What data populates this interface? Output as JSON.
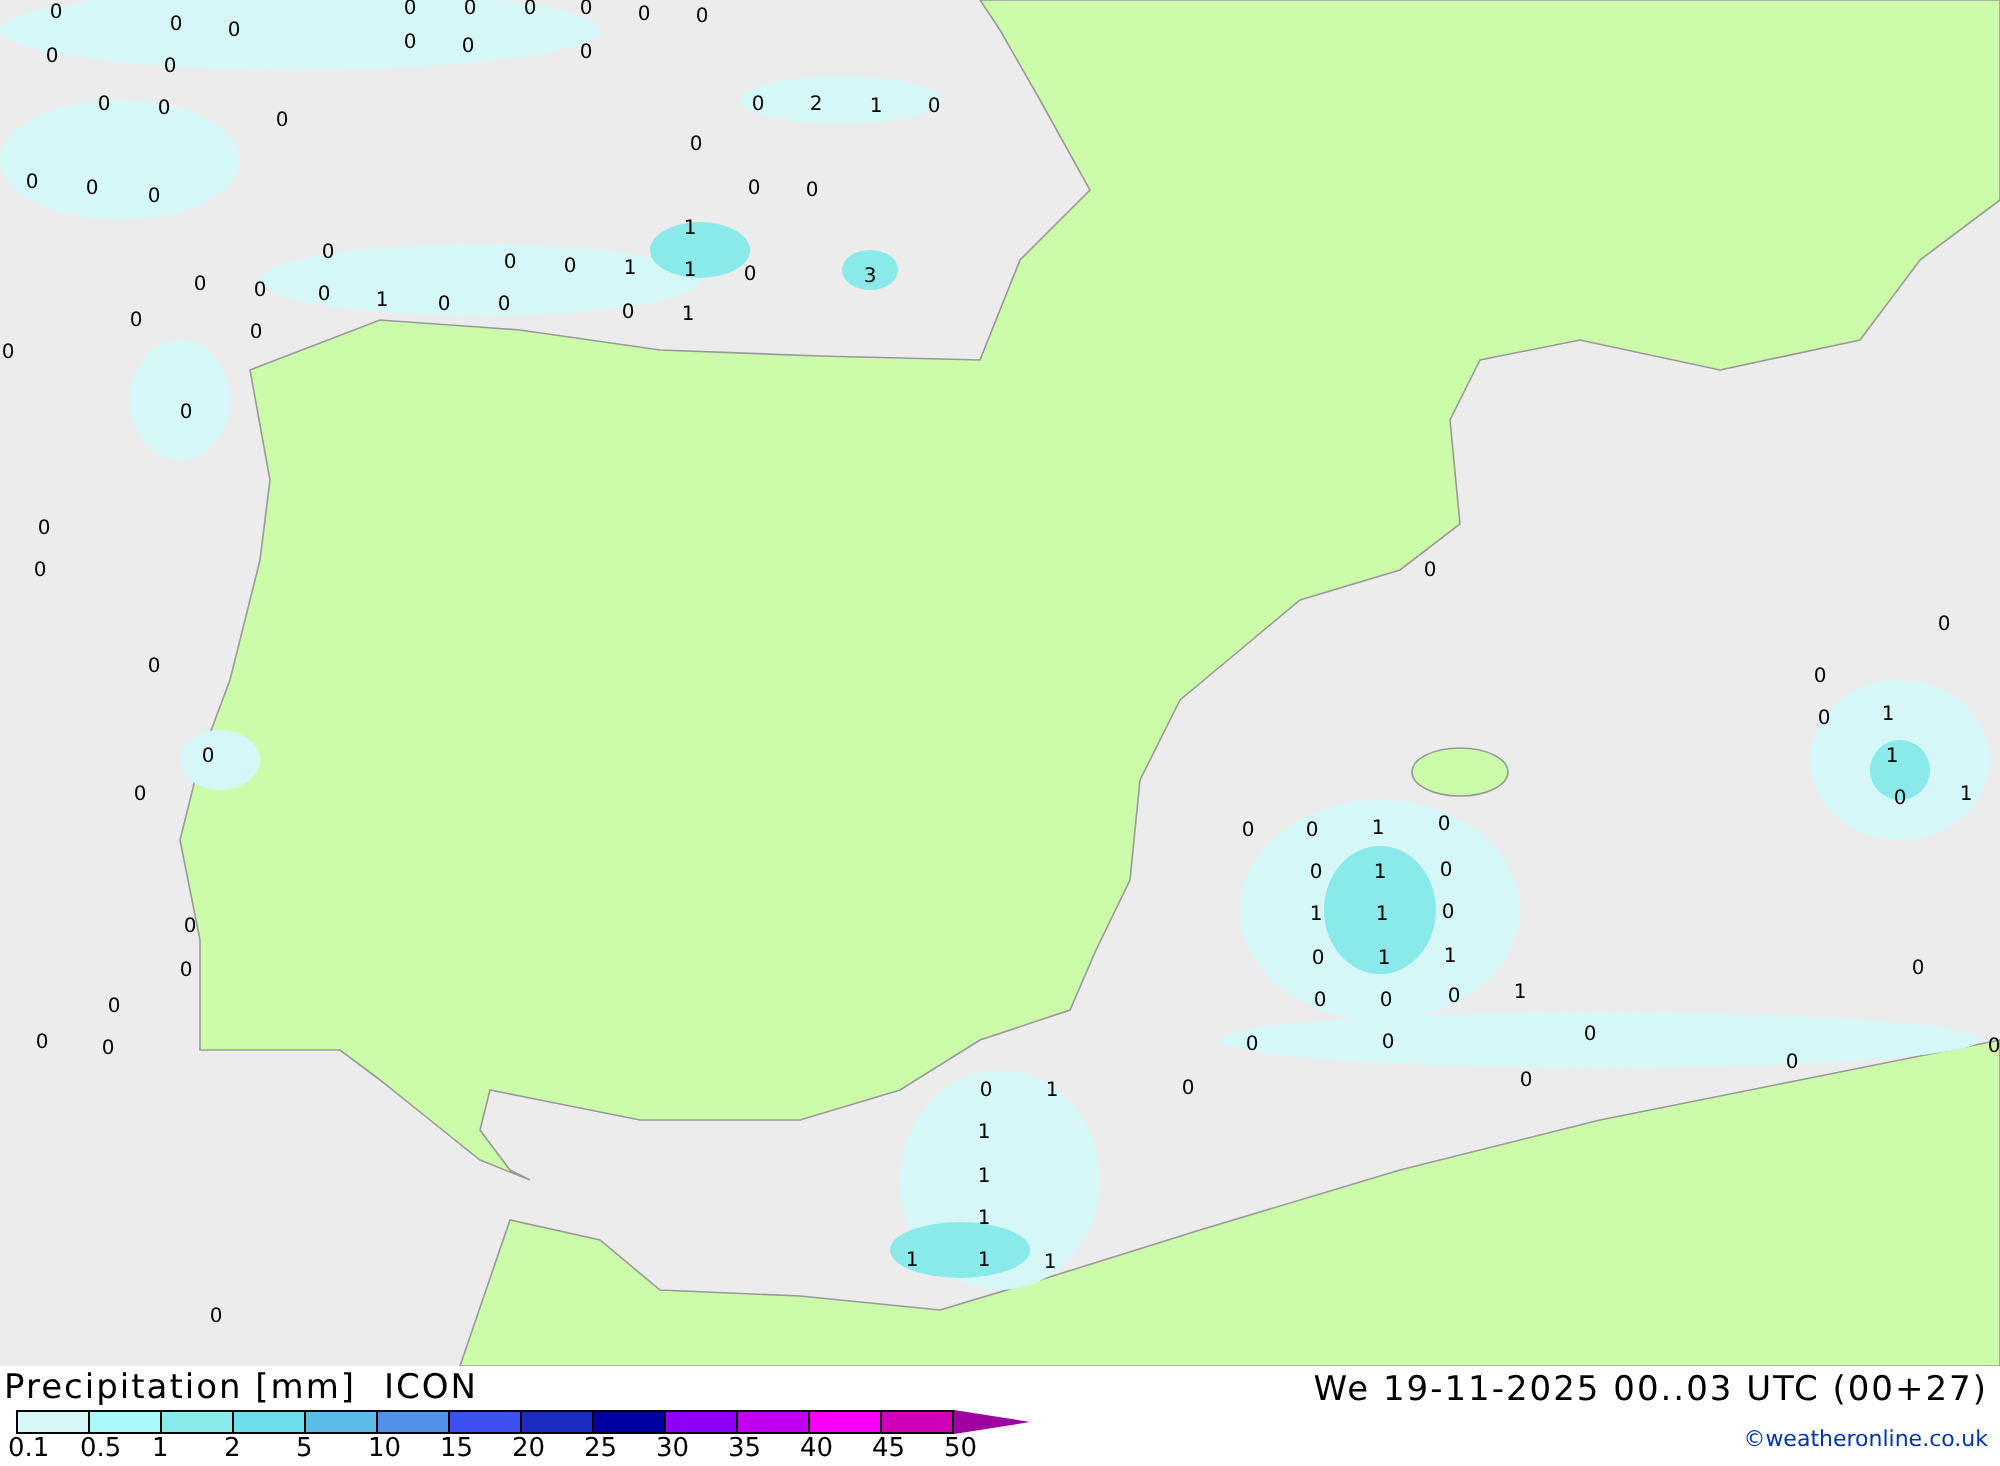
{
  "map": {
    "labels": [
      "0",
      "0",
      "0",
      "0",
      "0",
      "0",
      "0",
      "0",
      "0",
      "0",
      "0",
      "0",
      "0",
      "0",
      "0",
      "1",
      "0",
      "0",
      "0",
      "0",
      "0",
      "0",
      "0",
      "0",
      "0",
      "0",
      "0",
      "0",
      "0",
      "0",
      "0",
      "0",
      "0",
      "0",
      "0",
      "0",
      "0",
      "0",
      "0",
      "0",
      "0",
      "0",
      "0",
      "2",
      "1",
      "0",
      "0",
      "0",
      "0",
      "1",
      "0",
      "0",
      "1",
      "1",
      "0",
      "3",
      "0",
      "1",
      "0",
      "0",
      "0",
      "0",
      "1",
      "1",
      "0",
      "1",
      "0",
      "0",
      "1",
      "0",
      "0",
      "1",
      "0",
      "1",
      "1",
      "0",
      "0",
      "1",
      "1",
      "0",
      "0",
      "0",
      "1",
      "0",
      "0",
      "0",
      "0",
      "0",
      "0",
      "0",
      "1",
      "0",
      "0",
      "1",
      "1",
      "1",
      "1",
      "1",
      "1"
    ]
  },
  "footer": {
    "title": "Precipitation [mm]",
    "model": "ICON",
    "datetime": "We 19-11-2025 00..03 UTC (00+27)",
    "credit": "©weatheronline.co.uk"
  },
  "legend": [
    {
      "label": "0.1",
      "color": "#d6f7f7"
    },
    {
      "label": "0.5",
      "color": "#a8fafa"
    },
    {
      "label": "1",
      "color": "#8aeaea"
    },
    {
      "label": "2",
      "color": "#6ddcec"
    },
    {
      "label": "5",
      "color": "#5cbce8"
    },
    {
      "label": "10",
      "color": "#5092e8"
    },
    {
      "label": "15",
      "color": "#3c50f0"
    },
    {
      "label": "20",
      "color": "#1c2cc0"
    },
    {
      "label": "25",
      "color": "#0000a0"
    },
    {
      "label": "30",
      "color": "#9000f8"
    },
    {
      "label": "35",
      "color": "#c000f0"
    },
    {
      "label": "40",
      "color": "#f800f8"
    },
    {
      "label": "45",
      "color": "#d000b8"
    },
    {
      "label": "50",
      "color": "#a000a0"
    }
  ]
}
